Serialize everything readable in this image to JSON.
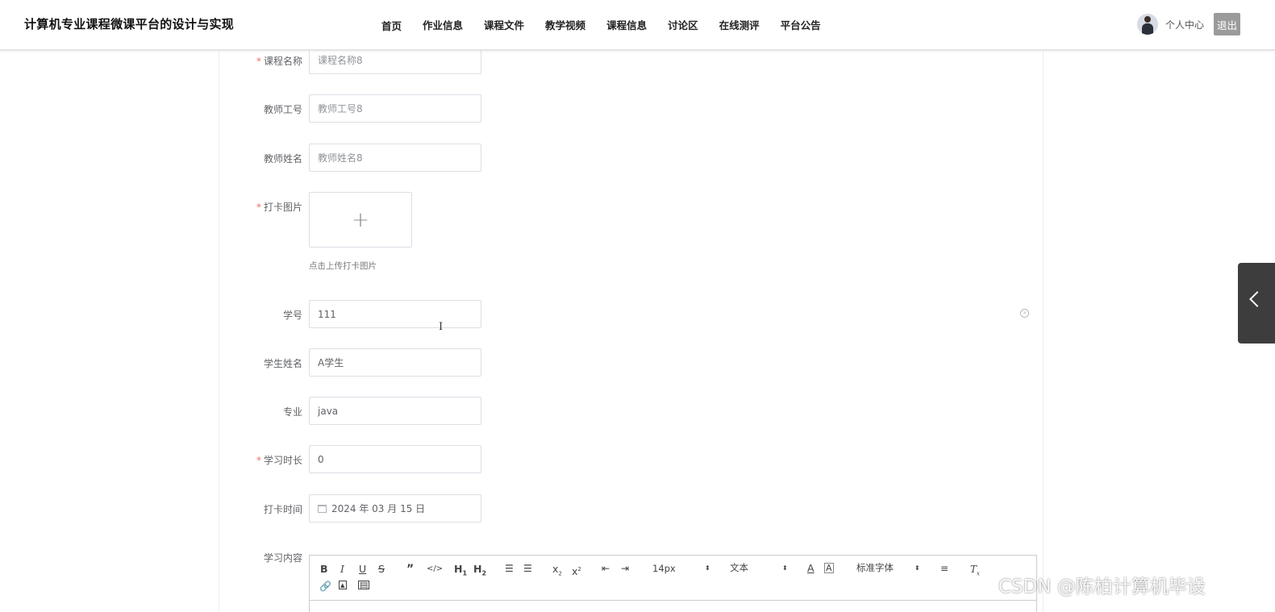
{
  "header": {
    "site_title": "计算机专业课程微课平台的设计与实现",
    "nav": [
      "首页",
      "作业信息",
      "课程文件",
      "教学视频",
      "课程信息",
      "讨论区",
      "在线测评",
      "平台公告"
    ],
    "personal_center": "个人中心",
    "logout": "退出"
  },
  "form": {
    "course_name": {
      "label": "课程名称",
      "value": "课程名称8",
      "required": true
    },
    "teacher_id": {
      "label": "教师工号",
      "value": "教师工号8"
    },
    "teacher_name": {
      "label": "教师姓名",
      "value": "教师姓名8"
    },
    "checkin_image": {
      "label": "打卡图片",
      "tip": "点击上传打卡图片",
      "required": true
    },
    "student_id": {
      "label": "学号",
      "value": "111"
    },
    "student_name": {
      "label": "学生姓名",
      "value": "A学生"
    },
    "major": {
      "label": "专业",
      "value": "java"
    },
    "study_duration": {
      "label": "学习时长",
      "value": "0",
      "required": true
    },
    "checkin_time": {
      "label": "打卡时间",
      "value": "2024 年 03 月 15 日"
    },
    "study_content": {
      "label": "学习内容"
    }
  },
  "required_mark": "*",
  "editor": {
    "font_size": "14px",
    "block_format": "文本",
    "font_family": "标准字体"
  },
  "watermark": "CSDN @陈柏计算机毕设"
}
